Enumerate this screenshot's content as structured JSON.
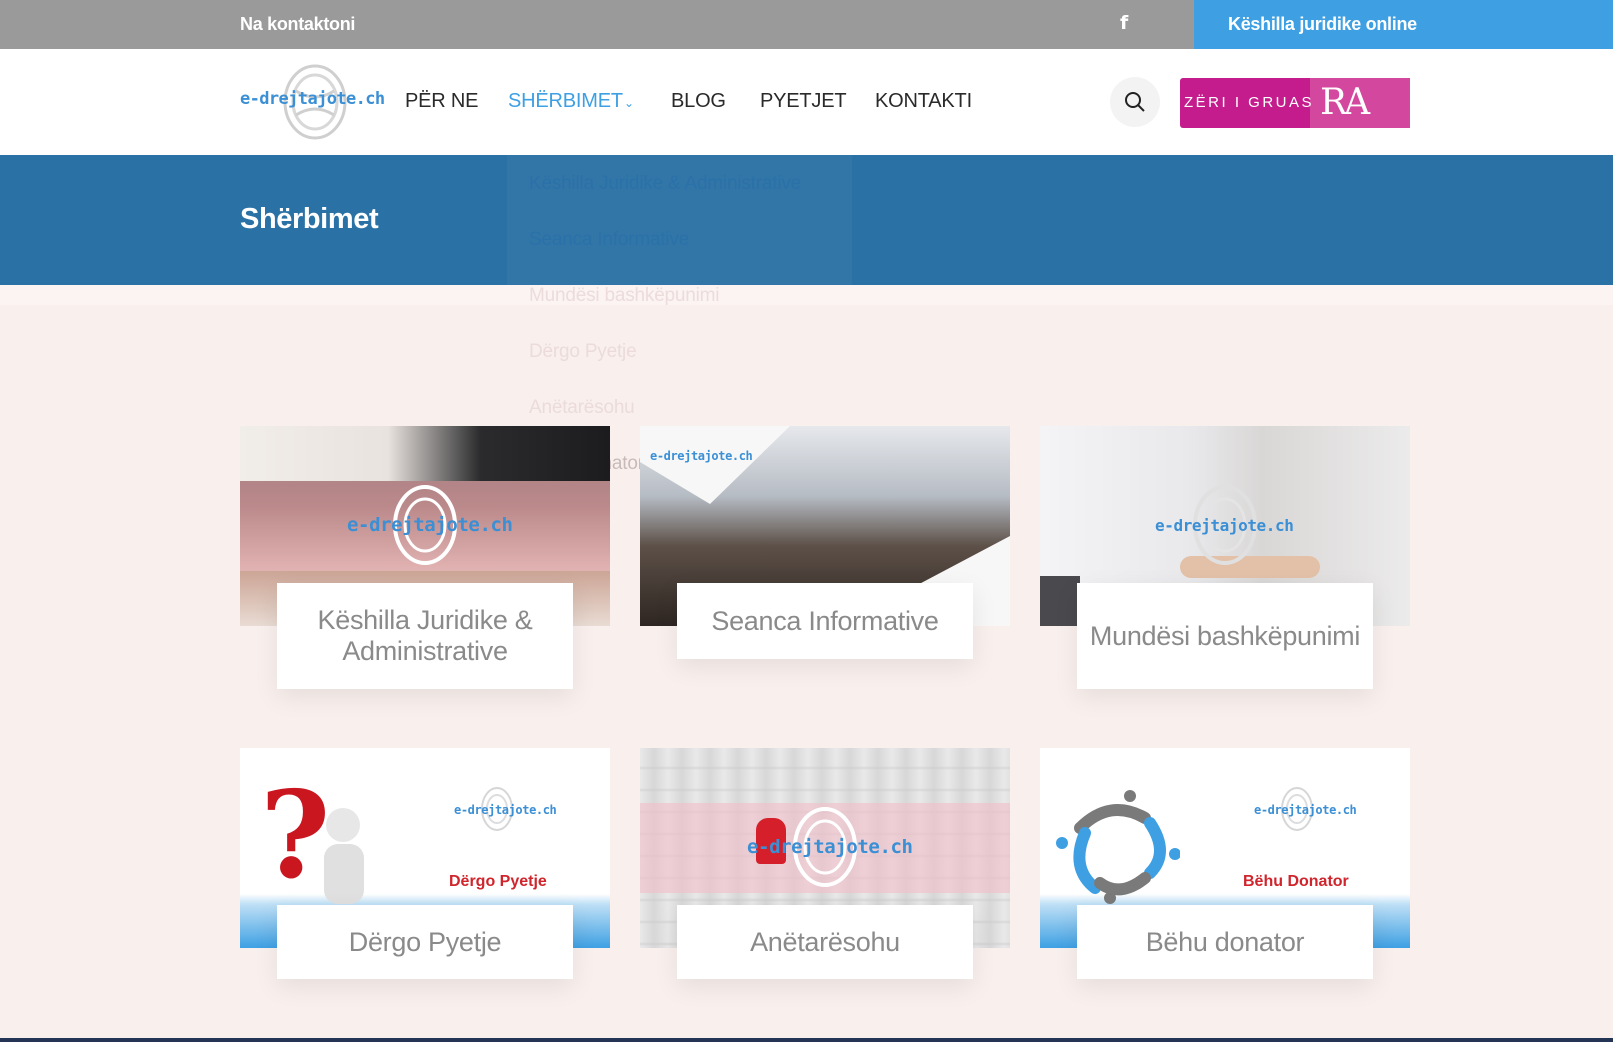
{
  "topbar": {
    "contact_label": "Na kontaktoni",
    "facebook_icon": "facebook-icon",
    "cta_label": "Këshilla juridike online"
  },
  "header": {
    "logo_text": "e-drejtajote.ch",
    "nav": [
      "PËR NE",
      "SHËRBIMET",
      "BLOG",
      "PYETJET",
      "KONTAKTI"
    ],
    "active_nav": "SHËRBIMET",
    "partner_text": "ZËRI I GRUAS",
    "partner_mark": "RA"
  },
  "banner": {
    "title": "Shërbimet"
  },
  "dropdown": [
    "Këshilla Juridike & Administrative",
    "Seanca Informative",
    "Mundësi bashkëpunimi",
    "Dërgo Pyetje",
    "Anëtarësohu",
    "Bëhu Donator"
  ],
  "cards": [
    {
      "title": "Këshilla Juridike & Administrative",
      "watermark": "e-drejtajote.ch"
    },
    {
      "title": "Seanca Informative",
      "watermark": "e-drejtajote.ch"
    },
    {
      "title": "Mundësi bashkëpunimi",
      "watermark": "e-drejtajote.ch"
    },
    {
      "title": "Dërgo Pyetje",
      "watermark": "e-drejtajote.ch",
      "badge": "Dërgo Pyetje"
    },
    {
      "title": "Anëtarësohu",
      "watermark": "e-drejtajote.ch"
    },
    {
      "title": "Bëhu donator",
      "watermark": "e-drejtajote.ch",
      "badge": "Bëhu Donator"
    }
  ],
  "colors": {
    "accent": "#3ea0e3",
    "banner": "#2a72a5",
    "partner": "#c41c8d",
    "background": "#f9f0ee"
  }
}
